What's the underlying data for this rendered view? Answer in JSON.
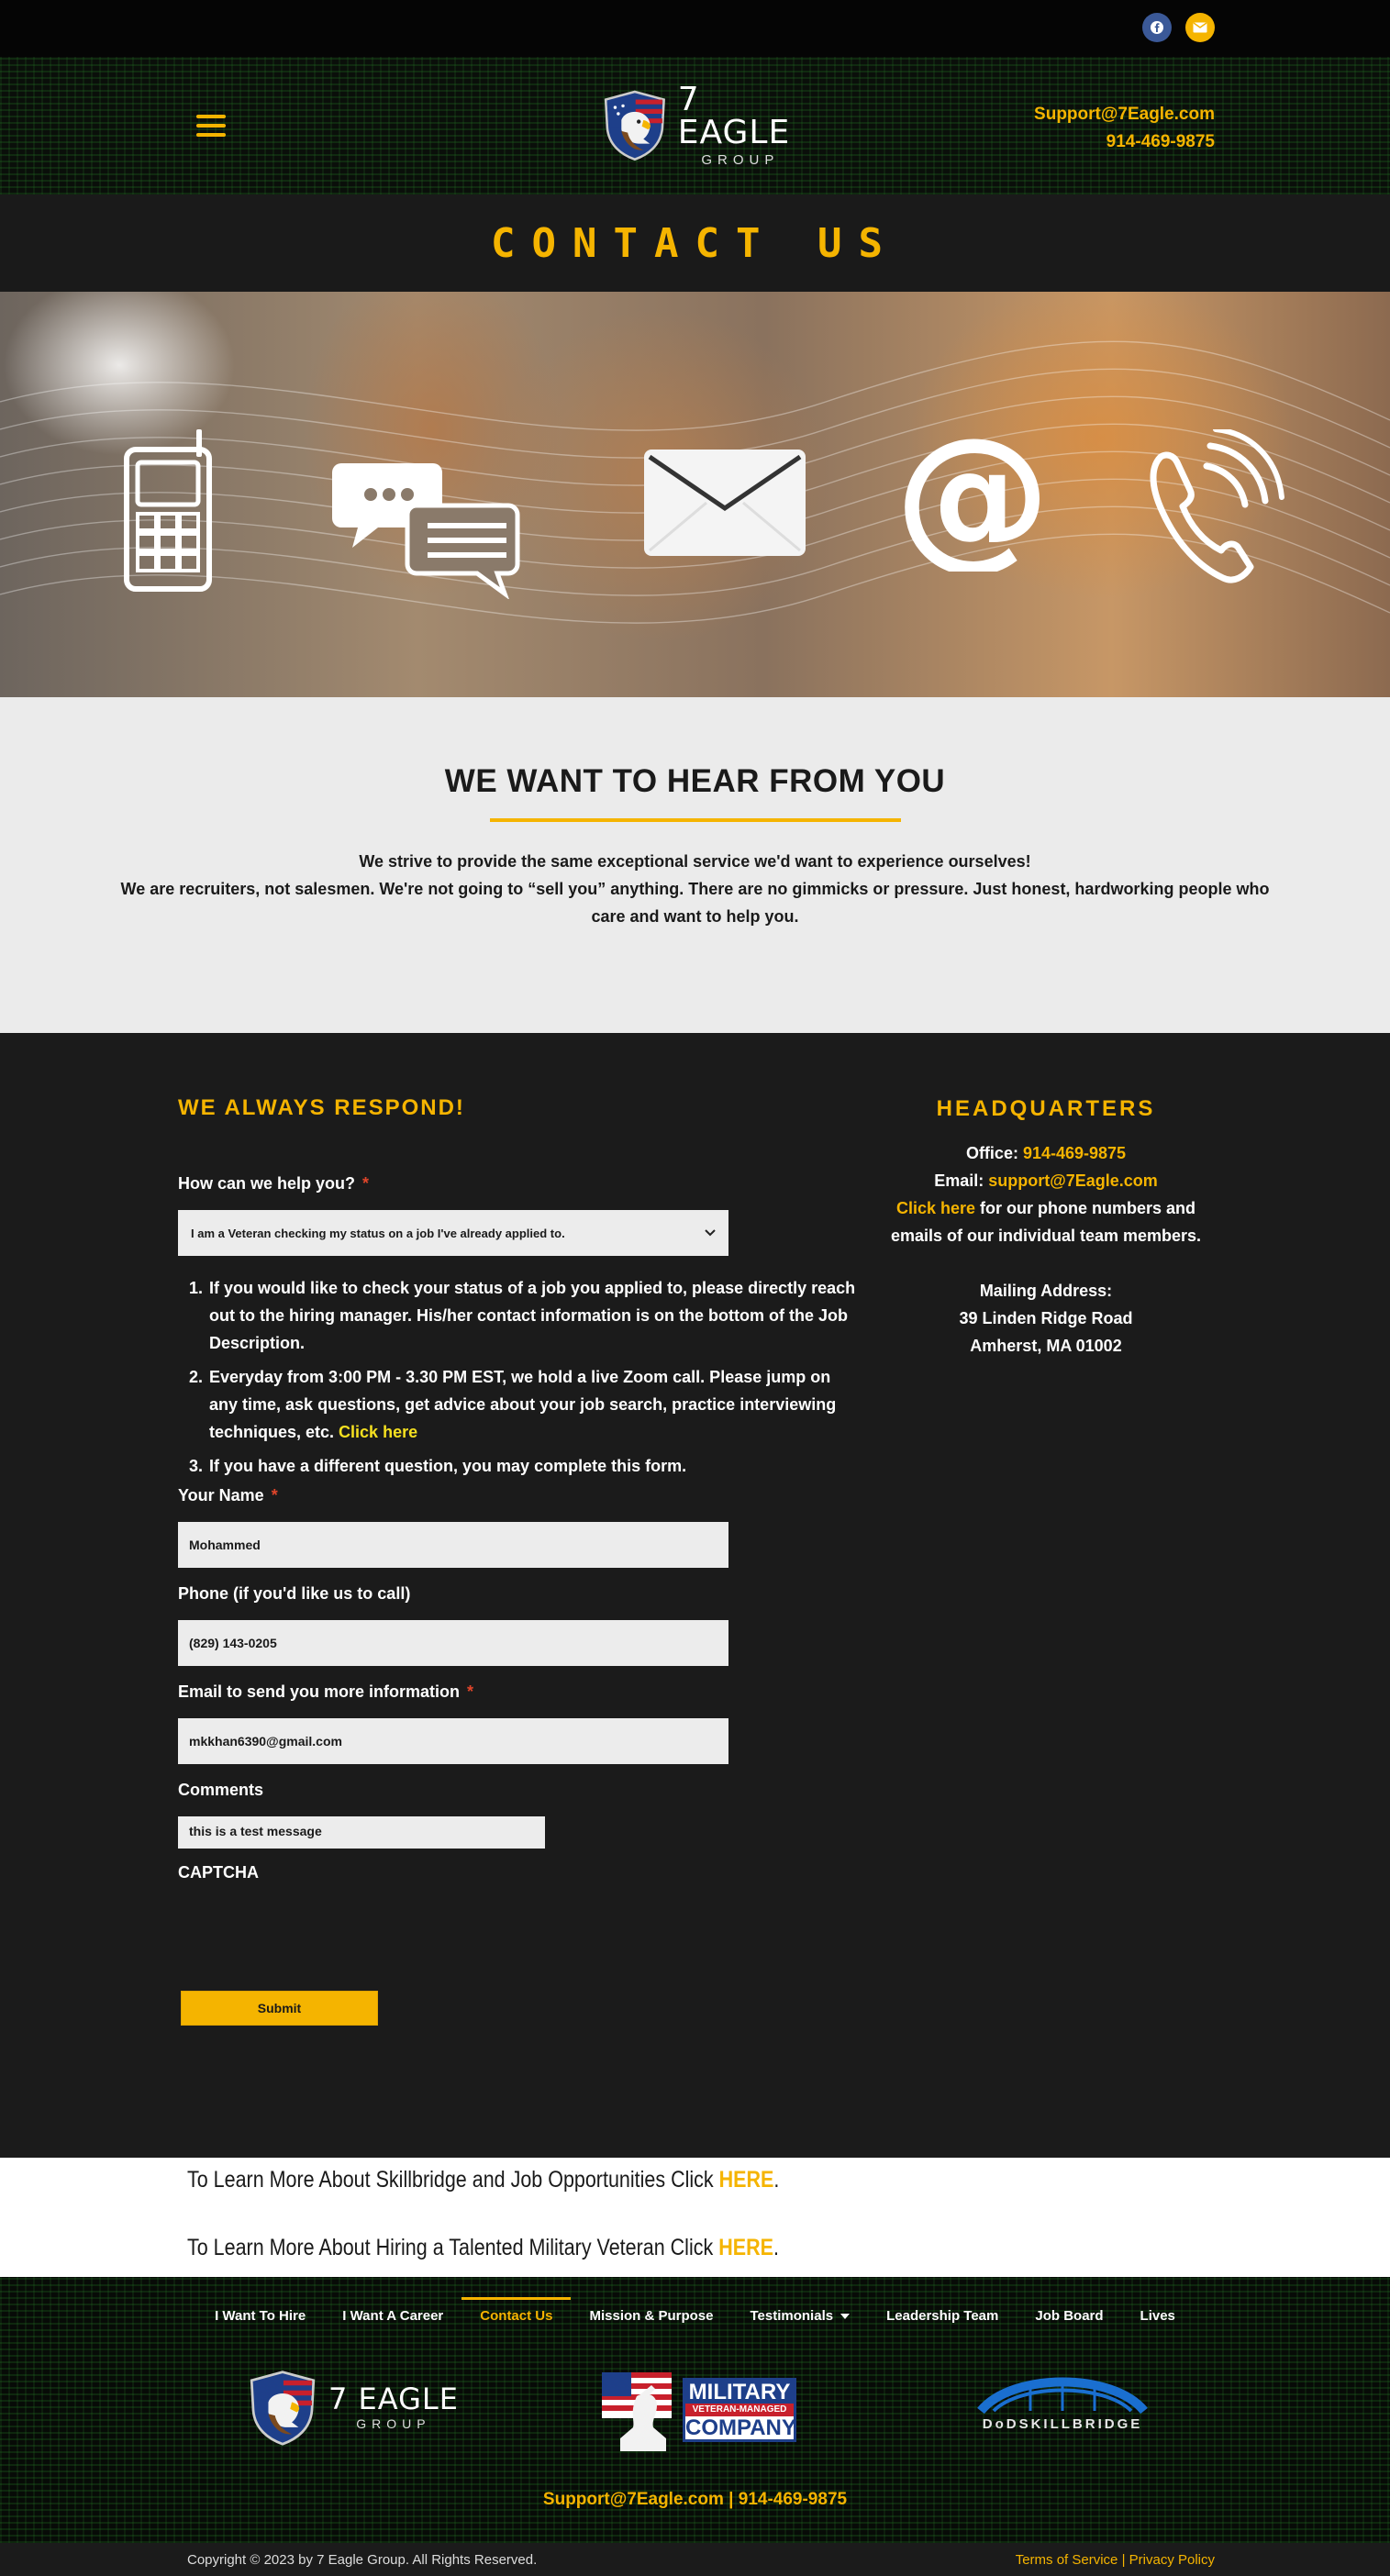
{
  "topbar": {
    "social": [
      {
        "name": "facebook-icon",
        "label": "f"
      },
      {
        "name": "envelope-icon",
        "label": "✉"
      }
    ]
  },
  "header": {
    "logo_big": "7 EAGLE",
    "logo_small": "GROUP",
    "email": "Support@7Eagle.com",
    "phone": "914-469-9875"
  },
  "page_title": "CONTACT US",
  "hear": {
    "heading": "WE WANT TO HEAR FROM YOU",
    "line1": "We strive to provide the same exceptional service we'd want to experience ourselves!",
    "line2": "We are recruiters, not salesmen. We're not going to “sell you” anything. There are no gimmicks or pressure. Just honest, hardworking people who care and want to help you."
  },
  "form": {
    "title": "WE ALWAYS RESPOND!",
    "help_label": "How can we help you?",
    "help_selected": "I am a Veteran checking my status on a job I've already applied to.",
    "steps": [
      {
        "text": "If you would like to check your status of a job you applied to, please directly reach out to the hiring manager.  His/her contact information is on the bottom of the Job Description.",
        "link": ""
      },
      {
        "text": "Everyday from 3:00 PM - 3.30 PM EST, we hold a live Zoom call. Please jump on any time, ask questions, get advice about your job search, practice interviewing techniques, etc. ",
        "link": "Click here"
      },
      {
        "text": "If you have a different question, you may complete this form.",
        "link": ""
      }
    ],
    "name_label": "Your Name",
    "name_value": "Mohammed",
    "phone_label": "Phone (if you'd like us to call)",
    "phone_value": "(829) 143-0205",
    "email_label": "Email to send you more information",
    "email_value": "mkkhan6390@gmail.com",
    "comments_label": "Comments",
    "comments_value": "this is a test message",
    "captcha_label": "CAPTCHA",
    "submit_label": "Submit",
    "required_mark": "*"
  },
  "hq": {
    "title": "HEADQUARTERS",
    "office_label": "Office: ",
    "office_phone": "914-469-9875",
    "email_label": "Email: ",
    "email": "support@7Eagle.com",
    "click_here": "Click here",
    "click_rest": " for our phone numbers and emails of our individual team members.",
    "mailing_label": "Mailing Address:",
    "address1": "39 Linden Ridge Road",
    "address2": "Amherst, MA  01002"
  },
  "learn": {
    "line1_text": "To Learn More About Skillbridge and Job Opportunities Click ",
    "line1_link": "HERE",
    "line2_text": "To Learn More About Hiring a Talented Military Veteran Click ",
    "line2_link": "HERE",
    "period": "."
  },
  "footer": {
    "nav": [
      {
        "label": "I Want To Hire",
        "active": false
      },
      {
        "label": "I Want A Career",
        "active": false
      },
      {
        "label": "Contact Us",
        "active": true
      },
      {
        "label": "Mission & Purpose",
        "active": false
      },
      {
        "label": "Testimonials",
        "active": false,
        "caret": true
      },
      {
        "label": "Leadership Team",
        "active": false
      },
      {
        "label": "Job Board",
        "active": false
      },
      {
        "label": "Lives",
        "active": false
      }
    ],
    "logo_big": "7 EAGLE",
    "logo_small": "GROUP",
    "military_line1": "MILITARY",
    "military_line2": "VETERAN-MANAGED",
    "military_line3": "COMPANY",
    "skillbridge": "DoDSKILLBRIDGE",
    "email": "Support@7Eagle.com",
    "sep": " | ",
    "phone": "914-469-9875"
  },
  "copyright": {
    "text": "Copyright © 2023 by 7 Eagle Group. All Rights Reserved.",
    "terms": "Terms of Service",
    "sep": " | ",
    "privacy": "Privacy Policy"
  },
  "colors": {
    "accent": "#f5b400",
    "dark": "#1b1b1b",
    "light": "#ebebeb"
  }
}
